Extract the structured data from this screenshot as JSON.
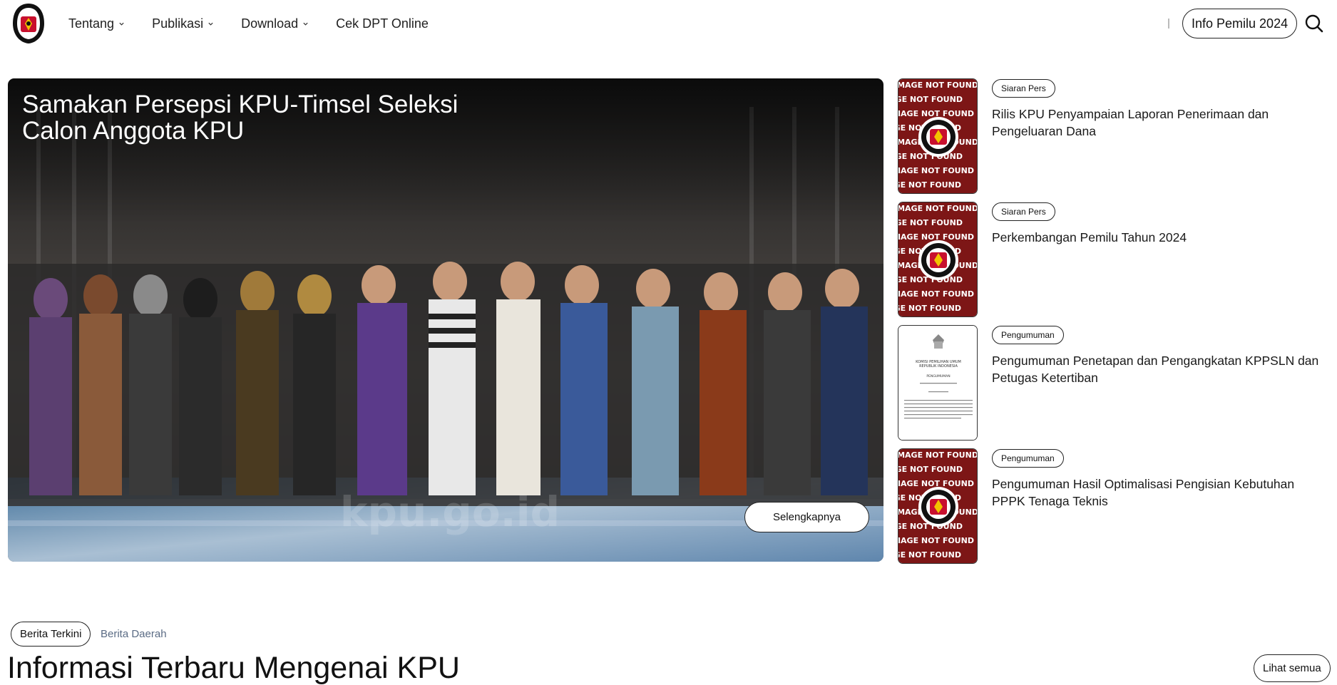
{
  "header": {
    "nav": [
      {
        "label": "Tentang",
        "has_dropdown": true
      },
      {
        "label": "Publikasi",
        "has_dropdown": true
      },
      {
        "label": "Download",
        "has_dropdown": true
      },
      {
        "label": "Cek DPT Online",
        "has_dropdown": false
      }
    ],
    "info_button": "Info Pemilu 2024",
    "logo_text": "KOMISI PEMILIHAN UMUM"
  },
  "hero": {
    "title": "Samakan Persepsi KPU-Timsel Seleksi Calon Anggota KPU",
    "button": "Selengkapnya",
    "watermark": "kpu.go.id"
  },
  "side_news": [
    {
      "category": "Siaran Pers",
      "title": "Rilis KPU Penyampaian Laporan Penerimaan dan Pengeluaran Dana",
      "thumb": "image-not-found"
    },
    {
      "category": "Siaran Pers",
      "title": "Perkembangan Pemilu Tahun 2024",
      "thumb": "image-not-found"
    },
    {
      "category": "Pengumuman",
      "title": "Pengumuman Penetapan dan Pengangkatan KPPSLN dan Petugas Ketertiban",
      "thumb": "document"
    },
    {
      "category": "Pengumuman",
      "title": "Pengumuman Hasil Optimalisasi Pengisian Kebutuhan PPPK Tenaga Teknis",
      "thumb": "image-not-found"
    }
  ],
  "not_found_text": "IMAGE NOT FOUND",
  "doc_thumb": {
    "line1": "KOMISI PEMILIHAN UMUM",
    "line2": "REPUBLIK INDONESIA",
    "line3": "PENGUMUMAN"
  },
  "latest": {
    "tab_active": "Berita Terkini",
    "tab_inactive": "Berita Daerah",
    "title": "Informasi Terbaru Mengenai KPU",
    "see_all": "Lihat semua"
  },
  "colors": {
    "kpu_red": "#8b1a1a",
    "text_dark": "#111111",
    "tab_muted": "#5a6b84"
  }
}
